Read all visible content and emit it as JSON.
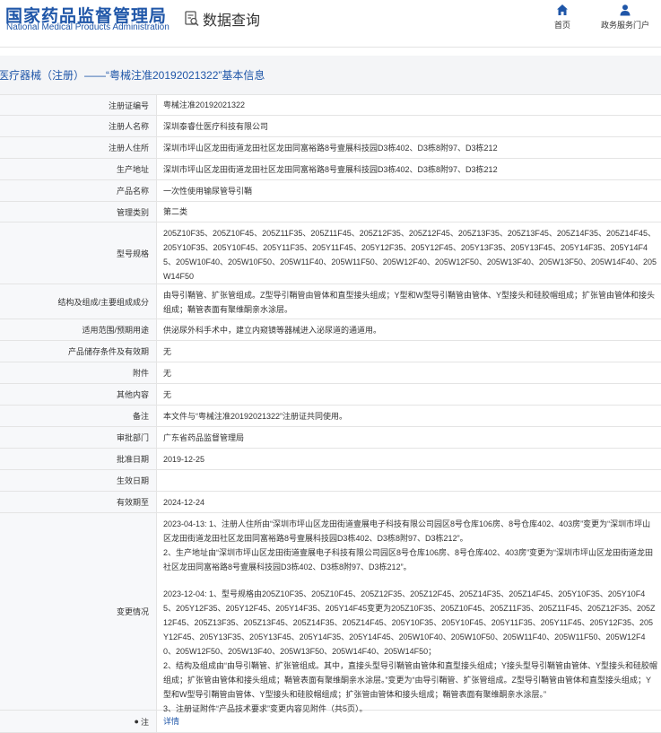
{
  "header": {
    "logo_cn": "国家药品监督管理局",
    "logo_en": "National Medical Products Administration",
    "query_label": "数据查询",
    "nav": [
      {
        "label": "首页",
        "icon": "home-icon"
      },
      {
        "label": "政务服务门户",
        "icon": "user-icon"
      }
    ]
  },
  "page_title": "医疗器械（注册）——“粤械注准20192021322”基本信息",
  "rows": [
    {
      "label": "注册证编号",
      "value": "粤械注准20192021322"
    },
    {
      "label": "注册人名称",
      "value": "深圳泰睿仕医疗科技有限公司"
    },
    {
      "label": "注册人住所",
      "value": "深圳市坪山区龙田街道龙田社区龙田同富裕路8号壹展科技园D3栋402、D3栋8附97、D3栋212"
    },
    {
      "label": "生产地址",
      "value": "深圳市坪山区龙田街道龙田社区龙田同富裕路8号壹展科技园D3栋402、D3栋8附97、D3栋212"
    },
    {
      "label": "产品名称",
      "value": "一次性使用输尿管导引鞘"
    },
    {
      "label": "管理类别",
      "value": "第二类"
    },
    {
      "label": "型号规格",
      "value": "205Z10F35、205Z10F45、205Z11F35、205Z11F45、205Z12F35、205Z12F45、205Z13F35、205Z13F45、205Z14F35、205Z14F45、205Y10F35、205Y10F45、205Y11F35、205Y11F45、205Y12F35、205Y12F45、205Y13F35、205Y13F45、205Y14F35、205Y14F45、205W10F40、205W10F50、205W11F40、205W11F50、205W12F40、205W12F50、205W13F40、205W13F50、205W14F40、205W14F50"
    },
    {
      "label": "结构及组成/主要组成成分",
      "value": "由导引鞘管、扩张管组成。Z型导引鞘管由管体和直型接头组成；Y型和W型导引鞘管由管体、Y型接头和硅胶帽组成；扩张管由管体和接头组成；鞘管表面有聚维酮亲水涂层。"
    },
    {
      "label": "适用范围/预期用途",
      "value": "供泌尿外科手术中，建立内窥镜等器械进入泌尿道的通道用。"
    },
    {
      "label": "产品储存条件及有效期",
      "value": "无"
    },
    {
      "label": "附件",
      "value": "无"
    },
    {
      "label": "其他内容",
      "value": "无"
    },
    {
      "label": "备注",
      "value": "本文件与“粤械注准20192021322”注册证共同使用。"
    },
    {
      "label": "审批部门",
      "value": "广东省药品监督管理局"
    },
    {
      "label": "批准日期",
      "value": "2019-12-25"
    },
    {
      "label": "生效日期",
      "value": ""
    },
    {
      "label": "有效期至",
      "value": "2024-12-24"
    },
    {
      "label": "变更情况",
      "p1": "2023-04-13: 1、注册人住所由“深圳市坪山区龙田街道壹展电子科技有限公司园区8号仓库106房、8号仓库402、403房”变更为“深圳市坪山区龙田街道龙田社区龙田同富裕路8号壹展科技园D3栋402、D3栋8附97、D3栋212”。",
      "p2": "2、生产地址由“深圳市坪山区龙田街道壹展电子科技有限公司园区8号仓库106房、8号仓库402、403房”变更为“深圳市坪山区龙田街道龙田社区龙田同富裕路8号壹展科技园D3栋402、D3栋8附97、D3栋212”。",
      "p3": "2023-12-04: 1、型号规格由205Z10F35、205Z10F45、205Z12F35、205Z12F45、205Z14F35、205Z14F45、205Y10F35、205Y10F45、205Y12F35、205Y12F45、205Y14F35、205Y14F45变更为205Z10F35、205Z10F45、205Z11F35、205Z11F45、205Z12F35、205Z12F45、205Z13F35、205Z13F45、205Z14F35、205Z14F45、205Y10F35、205Y10F45、205Y11F35、205Y11F45、205Y12F35、205Y12F45、205Y13F35、205Y13F45、205Y14F35、205Y14F45、205W10F40、205W10F50、205W11F40、205W11F50、205W12F40、205W12F50、205W13F40、205W13F50、205W14F40、205W14F50；",
      "p4": "2、结构及组成由“由导引鞘管、扩张管组成。其中，直接头型导引鞘管由管体和直型接头组成；Y接头型导引鞘管由管体、Y型接头和硅胶帽组成；扩张管由管体和接头组成；鞘管表面有聚维酮亲水涂层。”变更为“由导引鞘管、扩张管组成。Z型导引鞘管由管体和直型接头组成；Y型和W型导引鞘管由管体、Y型接头和硅胶帽组成；扩张管由管体和接头组成；鞘管表面有聚维酮亲水涂层。”",
      "p5": "3、注册证附件“产品技术要求”变更内容见附件（共5页）。"
    },
    {
      "label": "注",
      "value": "详情"
    }
  ]
}
